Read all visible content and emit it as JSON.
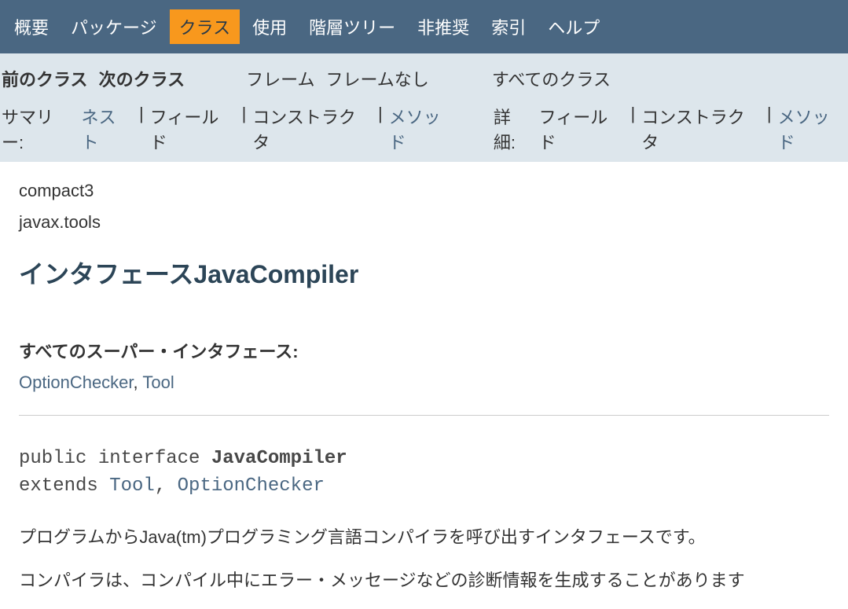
{
  "topnav": {
    "overview": "概要",
    "package": "パッケージ",
    "class": "クラス",
    "use": "使用",
    "tree": "階層ツリー",
    "deprecated": "非推奨",
    "index": "索引",
    "help": "ヘルプ"
  },
  "subnav": {
    "prev": "前のクラス",
    "next": "次のクラス",
    "frames": "フレーム",
    "noframes": "フレームなし",
    "allclasses": "すべてのクラス"
  },
  "summary": {
    "label": "サマリー:",
    "nested": "ネスト",
    "field": "フィールド",
    "constr": "コンストラクタ",
    "method": "メソッド"
  },
  "detail": {
    "label": "詳細:",
    "field": "フィールド",
    "constr": "コンストラクタ",
    "method": "メソッド"
  },
  "header": {
    "profile": "compact3",
    "package": "javax.tools",
    "title": "インタフェースJavaCompiler"
  },
  "super": {
    "label": "すべてのスーパー・インタフェース:",
    "optChecker": "OptionChecker",
    "sep": ", ",
    "tool": "Tool"
  },
  "signature": {
    "pre1": "public interface ",
    "name": "JavaCompiler",
    "pre2": "extends ",
    "tool": "Tool",
    "sep": ", ",
    "optChecker": "OptionChecker"
  },
  "desc": {
    "p1": "プログラムからJava(tm)プログラミング言語コンパイラを呼び出すインタフェースです。",
    "p2": "コンパイラは、コンパイル中にエラー・メッセージなどの診断情報を生成することがあります"
  }
}
